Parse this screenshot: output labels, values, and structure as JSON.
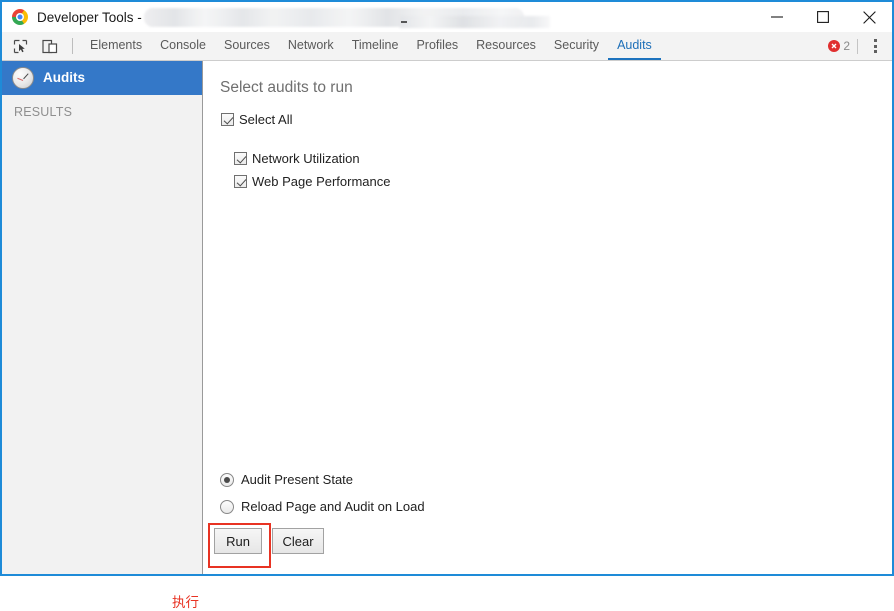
{
  "window": {
    "title": "Developer Tools -",
    "redacted_note": "blurred-url",
    "controls": {
      "minimize": "minimize-button",
      "maximize": "maximize-button",
      "close": "close-button"
    },
    "border_color": "#1e8bd8"
  },
  "toolbar": {
    "icons": [
      {
        "name": "inspect-element-icon"
      },
      {
        "name": "device-toolbar-icon"
      }
    ],
    "tabs": [
      {
        "label": "Elements",
        "active": false
      },
      {
        "label": "Console",
        "active": false
      },
      {
        "label": "Sources",
        "active": false
      },
      {
        "label": "Network",
        "active": false
      },
      {
        "label": "Timeline",
        "active": false
      },
      {
        "label": "Profiles",
        "active": false
      },
      {
        "label": "Resources",
        "active": false
      },
      {
        "label": "Security",
        "active": false
      },
      {
        "label": "Audits",
        "active": true
      }
    ],
    "error_badge": {
      "icon": "error-circle-icon",
      "count": "2",
      "color": "#e02f2f"
    },
    "menu_icon": "more-vertical-icon",
    "active_tab_color": "#1d73be"
  },
  "sidebar": {
    "selected_item": {
      "icon": "audits-gauge-icon",
      "label": "Audits"
    },
    "results_header": "RESULTS",
    "selected_bg": "#3478c8"
  },
  "main": {
    "title": "Select audits to run",
    "select_all": {
      "label": "Select All",
      "checked": true
    },
    "audits": [
      {
        "label": "Network Utilization",
        "checked": true
      },
      {
        "label": "Web Page Performance",
        "checked": true
      }
    ],
    "modes": [
      {
        "label": "Audit Present State",
        "selected": true
      },
      {
        "label": "Reload Page and Audit on Load",
        "selected": false
      }
    ],
    "buttons": {
      "run": "Run",
      "clear": "Clear"
    }
  },
  "annotation": {
    "text": "执行",
    "color": "#e83323"
  }
}
